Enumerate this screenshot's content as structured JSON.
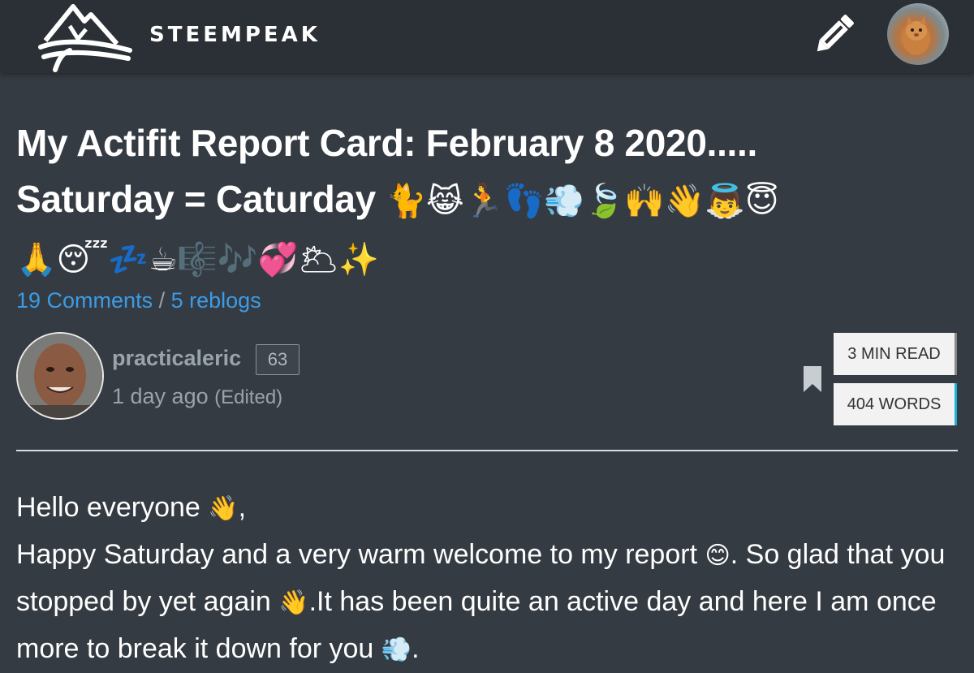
{
  "header": {
    "brand": "STEEMPEAK",
    "logo_icon": "mountain-waves-logo-icon",
    "edit_icon": "pencil-icon",
    "user_avatar": "user-avatar-kitten"
  },
  "post": {
    "title_line1": "My Actifit Report Card: February 8 2020.....",
    "title_line2_text": "Saturday = Caturday",
    "title_line2_emoji": "🐈😹🏃👣💨🍃🙌👋👼😇",
    "title_line3_emoji": "🙏😴💤☕🎼🎶💞🌥✨",
    "comments_label": "19 Comments",
    "separator": "/",
    "reblogs_label": "5 reblogs",
    "author": {
      "name": "practicaleric",
      "reputation": "63",
      "time": "1 day ago",
      "edited": "(Edited)"
    },
    "read_time": "3 MIN READ",
    "word_count": "404 WORDS",
    "bookmark_icon": "bookmark-icon",
    "body": {
      "line1_text": "Hello everyone",
      "line1_emoji": "👋",
      "line1_end": ",",
      "para2_a": "Happy Saturday and a very warm welcome to my report",
      "para2_emoji1": "😊",
      "para2_b": ". So glad that you stopped by yet again",
      "para2_emoji2": "👋",
      "para2_c": ".It has been quite an active day and here I am once more to break it down for you",
      "para2_emoji3": "💨",
      "para2_d": "."
    }
  },
  "colors": {
    "background": "#353b42",
    "topbar": "#2b3036",
    "link": "#3c9be6",
    "muted": "#9aa3ab",
    "word_count_accent": "#19b4d8"
  }
}
